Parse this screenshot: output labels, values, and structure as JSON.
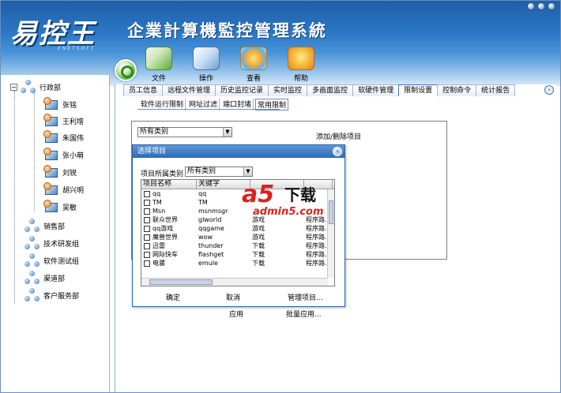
{
  "app": {
    "logo_text": "易控王",
    "logo_sub": "ENETSOFT",
    "title": "企業計算機監控管理系統"
  },
  "toolbar": {
    "items": [
      {
        "label": "文件",
        "icon": "file-icon"
      },
      {
        "label": "操作",
        "icon": "operate-icon"
      },
      {
        "label": "查看",
        "icon": "view-icon"
      },
      {
        "label": "帮助",
        "icon": "help-icon"
      }
    ]
  },
  "tree": {
    "root": "行政部",
    "users": [
      "张铭",
      "王利增",
      "朱国伟",
      "张小萌",
      "刘锐",
      "胡兴明",
      "吴敏"
    ],
    "groups": [
      "销售部",
      "技术研发组",
      "软件测试组",
      "渠道部",
      "客户服务部"
    ]
  },
  "tabs": [
    "员工信息",
    "远程文件管理",
    "历史监控记录",
    "实时监控",
    "多画面监控",
    "软硬件管理",
    "限制设置",
    "控制命令",
    "统计报告"
  ],
  "active_tab": "限制设置",
  "subtabs": [
    "软件运行限制",
    "网址过滤",
    "端口封堵",
    "常用限制"
  ],
  "active_subtab": "常用限制",
  "panel": {
    "category_select": "所有类别",
    "add_remove_link": "添加/删除项目"
  },
  "dialog": {
    "title": "选择项目",
    "category_label": "项目所属类别",
    "category_select": "所有类别",
    "columns": [
      "项目名称",
      "关键字",
      "",
      ""
    ],
    "rows": [
      {
        "name": "qq",
        "keyword": "qq",
        "type": "",
        "kind": ""
      },
      {
        "name": "TM",
        "keyword": "TM",
        "type": "",
        "kind": ""
      },
      {
        "name": "Msn",
        "keyword": "msnmsgr",
        "type": "",
        "kind": ""
      },
      {
        "name": "联众世界",
        "keyword": "glworld",
        "type": "游戏",
        "kind": "程序路..."
      },
      {
        "name": "qq游戏",
        "keyword": "qqgame",
        "type": "游戏",
        "kind": "程序路..."
      },
      {
        "name": "魔兽世界",
        "keyword": "wow",
        "type": "游戏",
        "kind": "程序路..."
      },
      {
        "name": "迅雷",
        "keyword": "thunder",
        "type": "下载",
        "kind": "程序路..."
      },
      {
        "name": "网际快车",
        "keyword": "flashget",
        "type": "下载",
        "kind": "程序路..."
      },
      {
        "name": "电骡",
        "keyword": "emule",
        "type": "下载",
        "kind": "程序路..."
      }
    ],
    "ok": "确定",
    "cancel": "取消",
    "manage": "管理项目..."
  },
  "apply": "应用",
  "batch_apply": "批量应用...",
  "watermark": {
    "brand": "a5",
    "text": "下载",
    "site": "admin5.com"
  }
}
